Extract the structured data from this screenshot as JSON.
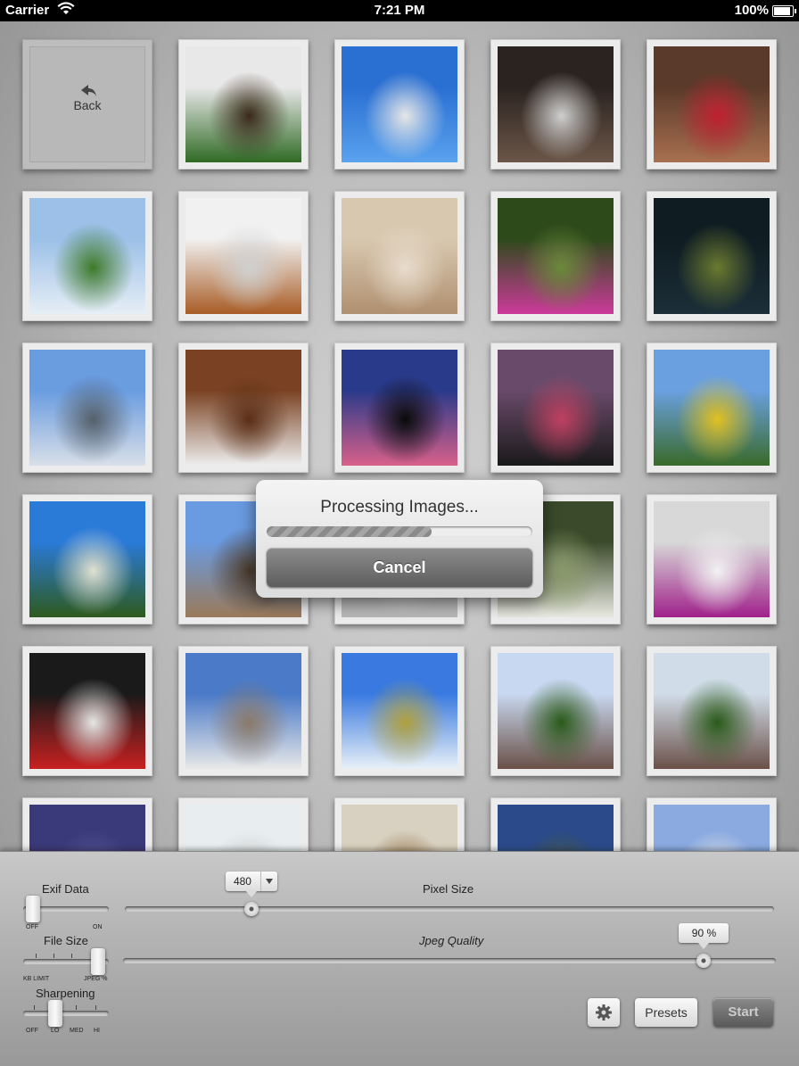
{
  "status_bar": {
    "carrier": "Carrier",
    "time": "7:21 PM",
    "battery": "100%",
    "battery_level": 1.0
  },
  "grid": {
    "back_label": "Back",
    "thumbnails": [
      {
        "name": "thumb-plant",
        "colors": [
          "#e8e8e8",
          "#2f6a24",
          "#3a2a1a"
        ]
      },
      {
        "name": "thumb-windmill",
        "colors": [
          "#2a6fd2",
          "#5aa2ee",
          "#e6e6e6"
        ]
      },
      {
        "name": "thumb-interior",
        "colors": [
          "#2b2320",
          "#6b5648",
          "#cfcfcf"
        ]
      },
      {
        "name": "thumb-red-flowers",
        "colors": [
          "#5a3a2a",
          "#a87050",
          "#c02030"
        ]
      },
      {
        "name": "thumb-field-sky",
        "colors": [
          "#9cc0e8",
          "#e6eef6",
          "#3e7a2a"
        ]
      },
      {
        "name": "thumb-teddy-bear",
        "colors": [
          "#f1f1f1",
          "#a85c25",
          "#d0d0d0"
        ]
      },
      {
        "name": "thumb-almonds",
        "colors": [
          "#d8c8b0",
          "#b09070",
          "#e8dccc"
        ]
      },
      {
        "name": "thumb-pink-flower",
        "colors": [
          "#2d4a1a",
          "#cc3a9a",
          "#6a8a3a"
        ]
      },
      {
        "name": "thumb-dark-lake",
        "colors": [
          "#0f1c22",
          "#1c2e38",
          "#6a7a30"
        ]
      },
      {
        "name": "thumb-mountain",
        "colors": [
          "#6a9ce0",
          "#d8dfe8",
          "#55606a"
        ]
      },
      {
        "name": "thumb-coffee",
        "colors": [
          "#7a4222",
          "#eeeeee",
          "#5a2e16"
        ]
      },
      {
        "name": "thumb-sunset-silhouette",
        "colors": [
          "#2a3a8a",
          "#d8608a",
          "#0a0a0a"
        ]
      },
      {
        "name": "thumb-grill",
        "colors": [
          "#6a4a6a",
          "#1a1a1a",
          "#c04060"
        ]
      },
      {
        "name": "thumb-sunflowers",
        "colors": [
          "#6aa0e0",
          "#3a6a2a",
          "#e0c020"
        ]
      },
      {
        "name": "thumb-tree",
        "colors": [
          "#2a7ad8",
          "#2e5a1e",
          "#e0e0d0"
        ]
      },
      {
        "name": "thumb-stone-house",
        "colors": [
          "#6a9ae0",
          "#9a7a5a",
          "#4a3a2a"
        ]
      },
      {
        "name": "thumb-hidden",
        "colors": [
          "#c8c8c8",
          "#b8b8b8",
          "#d0d0d0"
        ]
      },
      {
        "name": "thumb-white-flowers",
        "colors": [
          "#3a4a2a",
          "#e8e8e0",
          "#8a9a6a"
        ]
      },
      {
        "name": "thumb-bougainvillea",
        "colors": [
          "#d8d8d8",
          "#a0208a",
          "#f2f2f2"
        ]
      },
      {
        "name": "thumb-subway",
        "colors": [
          "#1a1a1a",
          "#c82020",
          "#e6e6e6"
        ]
      },
      {
        "name": "thumb-ferris-wheel",
        "colors": [
          "#4a7ac8",
          "#e8e8e8",
          "#8a7a6a"
        ]
      },
      {
        "name": "thumb-wheat-field",
        "colors": [
          "#3a7ae0",
          "#e8f0f8",
          "#b0a040"
        ]
      },
      {
        "name": "thumb-cathedral",
        "colors": [
          "#c8d8f0",
          "#6a5048",
          "#2a5a1a"
        ]
      },
      {
        "name": "thumb-cathedral-2",
        "colors": [
          "#d0dce8",
          "#6a5048",
          "#2a5a1a"
        ]
      },
      {
        "name": "thumb-pink-sky",
        "colors": [
          "#3a3a7a",
          "#b04a6a",
          "#5a5a9a"
        ]
      },
      {
        "name": "thumb-snow",
        "colors": [
          "#e8eef0",
          "#6a7a6a",
          "#c8c8c8"
        ]
      },
      {
        "name": "thumb-bread",
        "colors": [
          "#d8d0c0",
          "#c09040",
          "#8a6a3a"
        ]
      },
      {
        "name": "thumb-coast",
        "colors": [
          "#2a4a8a",
          "#9ab8d8",
          "#4a5a3a"
        ]
      },
      {
        "name": "thumb-house-roof",
        "colors": [
          "#8aaae0",
          "#6a7078",
          "#e8e8e8"
        ]
      }
    ]
  },
  "modal": {
    "title": "Processing Images...",
    "progress": 0.62,
    "cancel_label": "Cancel"
  },
  "panel": {
    "exif": {
      "label": "Exif Data",
      "off_label": "OFF",
      "on_label": "ON",
      "value": "OFF"
    },
    "file_size": {
      "label": "File Size",
      "left_label": "KB LIMIT",
      "right_label": "JPEG %",
      "value": "JPEG %"
    },
    "sharpening": {
      "label": "Sharpening",
      "options": [
        "OFF",
        "LO",
        "MED",
        "HI"
      ],
      "value": "LO"
    },
    "pixel_size": {
      "label": "Pixel Size",
      "value": "480",
      "fraction": 0.195
    },
    "jpeg_quality": {
      "label": "Jpeg Quality",
      "value": "90 %",
      "fraction": 0.89
    },
    "buttons": {
      "presets": "Presets",
      "start": "Start"
    }
  }
}
